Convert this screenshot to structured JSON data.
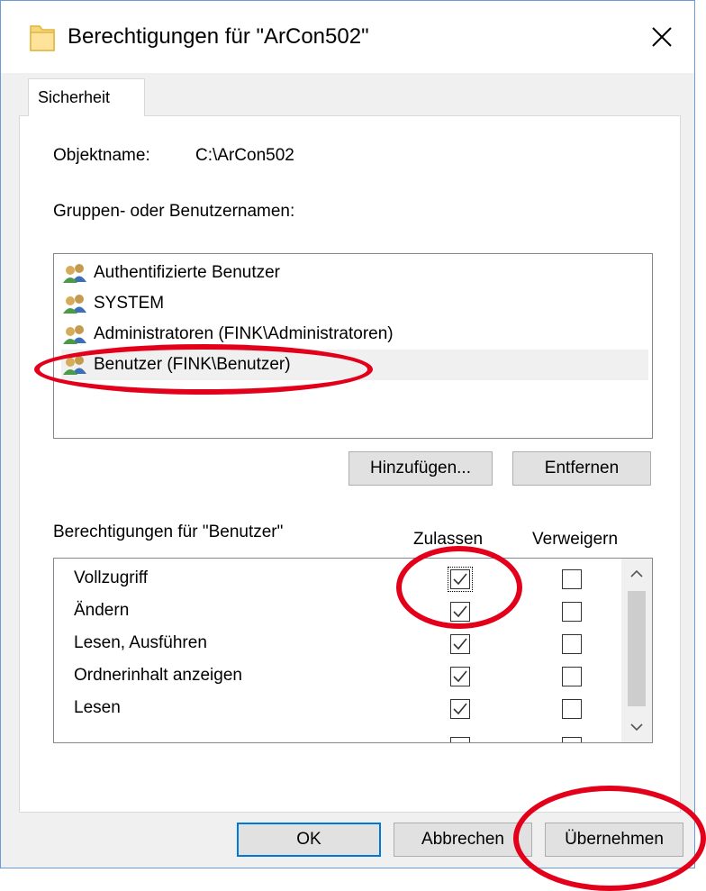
{
  "window": {
    "title": "Berechtigungen für \"ArCon502\"",
    "close_icon": "close-icon",
    "border_color": "#6b9bd6"
  },
  "tabs": [
    {
      "label": "Sicherheit",
      "active": true
    }
  ],
  "object": {
    "label": "Objektname:",
    "value": "C:\\ArCon502"
  },
  "groups": {
    "label": "Gruppen- oder Benutzernamen:",
    "items": [
      {
        "label": "Authentifizierte Benutzer",
        "icon": "users-icon"
      },
      {
        "label": "SYSTEM",
        "icon": "users-icon"
      },
      {
        "label": "Administratoren (FINK\\Administratoren)",
        "icon": "users-icon"
      },
      {
        "label": "Benutzer (FINK\\Benutzer)",
        "icon": "users-icon",
        "selected": true
      }
    ]
  },
  "group_buttons": {
    "add": "Hinzufügen...",
    "remove": "Entfernen"
  },
  "permissions": {
    "title": "Berechtigungen für \"Benutzer\"",
    "col_allow": "Zulassen",
    "col_deny": "Verweigern",
    "rows": [
      {
        "label": "Vollzugriff",
        "allow": true,
        "deny": false
      },
      {
        "label": "Ändern",
        "allow": true,
        "deny": false
      },
      {
        "label": "Lesen, Ausführen",
        "allow": true,
        "deny": false
      },
      {
        "label": "Ordnerinhalt anzeigen",
        "allow": true,
        "deny": false
      },
      {
        "label": "Lesen",
        "allow": true,
        "deny": false
      }
    ]
  },
  "footer": {
    "ok": "OK",
    "cancel": "Abbrechen",
    "apply": "Übernehmen"
  },
  "annotation_color": "#e3001b",
  "accent_color": "#0078d7"
}
